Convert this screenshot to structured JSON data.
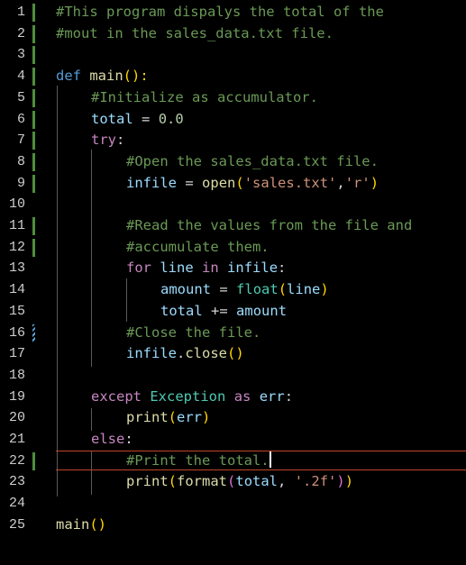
{
  "editor": {
    "line_numbers": [
      "1",
      "2",
      "3",
      "4",
      "5",
      "6",
      "7",
      "8",
      "9",
      "10",
      "11",
      "12",
      "13",
      "14",
      "15",
      "16",
      "17",
      "18",
      "19",
      "20",
      "21",
      "22",
      "23",
      "24",
      "25"
    ],
    "active_line": "22",
    "lines": {
      "l1": {
        "c1": "#This program dispalys the total of the"
      },
      "l2": {
        "c1": "#mout in the sales_data.txt file."
      },
      "l4": {
        "kw": "def",
        "fn": "main",
        "p": "():"
      },
      "l5": {
        "c1": "#Initialize as accumulator."
      },
      "l6": {
        "v": "total",
        "op": "=",
        "n": "0.0"
      },
      "l7": {
        "kw": "try",
        "p": ":"
      },
      "l8": {
        "c1": "#Open the sales_data.txt file."
      },
      "l9": {
        "v": "infile",
        "op": "=",
        "fn": "open",
        "s1": "'sales.txt'",
        "comma": ",",
        "s2": "'r'"
      },
      "l11": {
        "c1": "#Read the values from the file and"
      },
      "l12": {
        "c1": "#accumulate them."
      },
      "l13": {
        "kw1": "for",
        "v1": "line",
        "kw2": "in",
        "v2": "infile",
        "p": ":"
      },
      "l14": {
        "v": "amount",
        "op": "=",
        "cls": "float",
        "arg": "line"
      },
      "l15": {
        "v": "total",
        "op": "+=",
        "v2": "amount"
      },
      "l16": {
        "c1": "#Close the file."
      },
      "l17": {
        "v": "infile",
        "dot": ".",
        "fn": "close"
      },
      "l19": {
        "kw": "except",
        "cls": "Exception",
        "kw2": "as",
        "v": "err",
        "p": ":"
      },
      "l20": {
        "fn": "print",
        "arg": "err"
      },
      "l21": {
        "kw": "else",
        "p": ":"
      },
      "l22": {
        "c1": "#Print the total."
      },
      "l23": {
        "fn": "print",
        "fn2": "format",
        "arg": "total",
        "comma": ",",
        "s": "'.2f'"
      },
      "l25": {
        "fn": "main"
      }
    }
  }
}
